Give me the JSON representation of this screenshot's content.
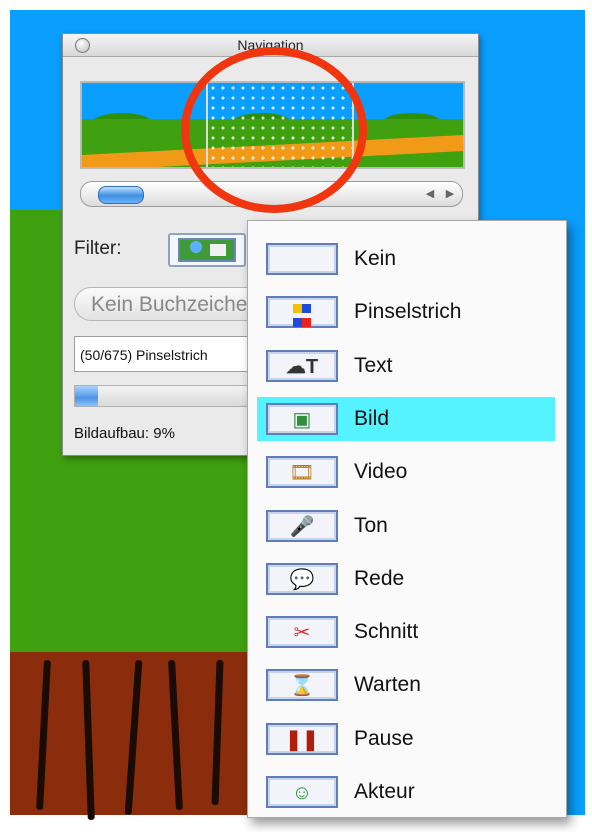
{
  "window": {
    "title": "Navigation",
    "filter_label": "Filter:",
    "bookmark_button": "Kein Buchzeichen",
    "status_text": "(50/675) Pinselstrich",
    "progress_percent": 9,
    "build_label": "Bildaufbau: 9%"
  },
  "menu": {
    "selected": "Bild",
    "items": [
      {
        "label": "Kein",
        "icon": "empty-icon"
      },
      {
        "label": "Pinselstrich",
        "icon": "color-squares-icon"
      },
      {
        "label": "Text",
        "icon": "speech-text-icon"
      },
      {
        "label": "Bild",
        "icon": "picture-icon"
      },
      {
        "label": "Video",
        "icon": "film-icon"
      },
      {
        "label": "Ton",
        "icon": "microphone-icon"
      },
      {
        "label": "Rede",
        "icon": "speech-icon"
      },
      {
        "label": "Schnitt",
        "icon": "scissors-icon"
      },
      {
        "label": "Warten",
        "icon": "hourglass-icon"
      },
      {
        "label": "Pause",
        "icon": "pause-icon"
      },
      {
        "label": "Akteur",
        "icon": "actor-icon"
      }
    ]
  },
  "colors": {
    "sky": "#0a9fff",
    "grass": "#3fa010",
    "trunk": "#8b2d0c",
    "highlight": "#54f3ff",
    "annotation_circle": "#f0350f"
  }
}
